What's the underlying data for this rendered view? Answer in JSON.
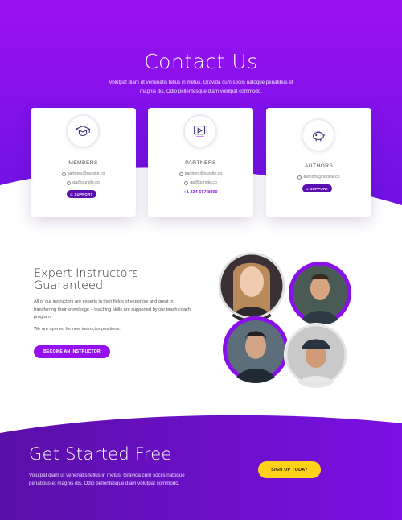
{
  "hero": {
    "title": "Contact Us",
    "subtitle": "Volutpat diam ut venenatis tellus in metus. Gravida cum sociis natoque penatibus et magnis dis. Odio pellentesque diam volutpat commodo."
  },
  "cards": [
    {
      "title": "MEMBERS",
      "icon": "graduation-cap-icon",
      "email1": "partners@oursite.co",
      "email2": "qa@oursite.co",
      "button": "SUPPORT"
    },
    {
      "title": "PARTNERS",
      "icon": "video-play-icon",
      "email1": "partners@oursite.co",
      "email2": "qa@oursite.co",
      "phone": "+1 234 567 8890"
    },
    {
      "title": "AUTHORS",
      "icon": "piggy-bank-icon",
      "email1": "authors@oursite.co",
      "button": "SUPPORT"
    }
  ],
  "instructors": {
    "title_line1": "Expert Instructors",
    "title_line2": "Guaranteed",
    "text": "All of our instructors are experts in their fields of expertise and great in transferring their knowledge – teaching skills are supported by our teach coach program",
    "text2": "We are opened for new instructor positions.",
    "button": "BECOME AN INSTRUCTOR"
  },
  "get_started": {
    "title": "Get Started Free",
    "subtitle": "Volutpat diam ut venenatis tellus in metus. Gravida cum sociis natoque penatibus et magnis dis. Odio pellentesque diam volutpat commodo.",
    "button": "SIGN UP TODAY"
  },
  "colors": {
    "purple": "#9410ee",
    "deep_purple": "#5a0fb0",
    "yellow": "#ffd21a"
  }
}
